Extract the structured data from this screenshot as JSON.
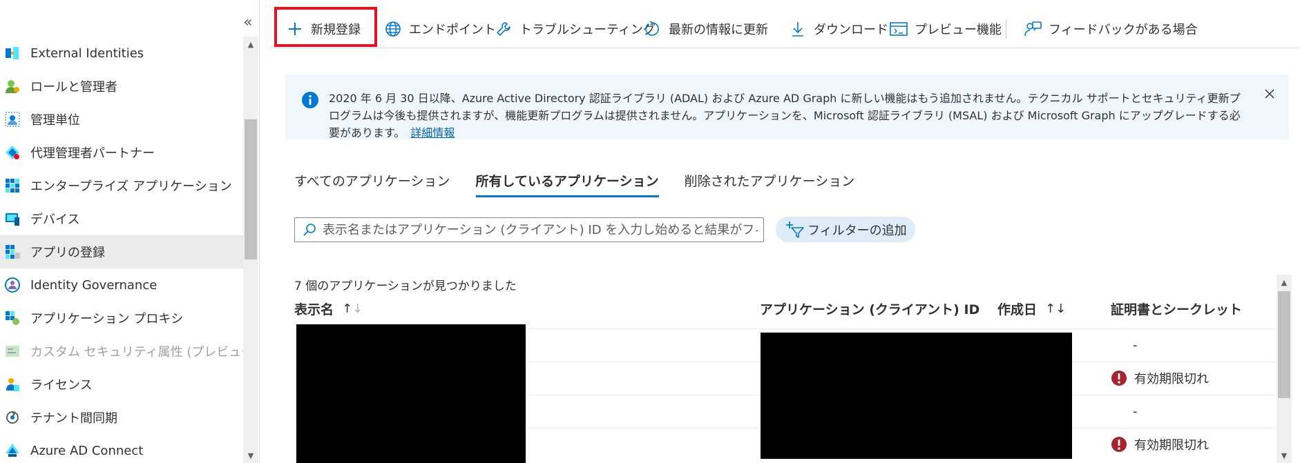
{
  "sidebar": {
    "collapse_glyph": "«",
    "items": [
      {
        "label": "External Identities",
        "icon": "external-identities-icon"
      },
      {
        "label": "ロールと管理者",
        "icon": "roles-admins-icon"
      },
      {
        "label": "管理単位",
        "icon": "admin-units-icon"
      },
      {
        "label": "代理管理者パートナー",
        "icon": "delegated-admin-partners-icon"
      },
      {
        "label": "エンタープライズ アプリケーション",
        "icon": "enterprise-apps-icon"
      },
      {
        "label": "デバイス",
        "icon": "devices-icon"
      },
      {
        "label": "アプリの登録",
        "icon": "app-registrations-icon",
        "selected": true
      },
      {
        "label": "Identity Governance",
        "icon": "identity-governance-icon"
      },
      {
        "label": "アプリケーション プロキシ",
        "icon": "app-proxy-icon"
      },
      {
        "label": "カスタム セキュリティ属性 (プレビュー)",
        "icon": "custom-security-attributes-icon",
        "disabled": true
      },
      {
        "label": "ライセンス",
        "icon": "licenses-icon"
      },
      {
        "label": "テナント間同期",
        "icon": "cross-tenant-sync-icon"
      },
      {
        "label": "Azure AD Connect",
        "icon": "azure-ad-connect-icon"
      }
    ]
  },
  "toolbar": {
    "new_registration": "新規登録",
    "endpoints": "エンドポイント",
    "troubleshooting": "トラブルシューティング",
    "refresh": "最新の情報に更新",
    "download": "ダウンロード",
    "preview_features": "プレビュー機能",
    "feedback": "フィードバックがある場合"
  },
  "banner": {
    "text": "2020 年 6 月 30 日以降、Azure Active Directory 認証ライブラリ (ADAL) および Azure AD Graph に新しい機能はもう追加されません。テクニカル サポートとセキュリティ更新プログラムは今後も提供されますが、機能更新プログラムは提供されません。アプリケーションを、Microsoft 認証ライブラリ (MSAL) および Microsoft Graph にアップグレードする必要があります。",
    "link": "詳細情報"
  },
  "tabs": [
    {
      "label": "すべてのアプリケーション",
      "active": false
    },
    {
      "label": "所有しているアプリケーション",
      "active": true
    },
    {
      "label": "削除されたアプリケーション",
      "active": false
    }
  ],
  "search": {
    "placeholder": "表示名またはアプリケーション (クライアント) ID を入力し始めると結果がフィル..."
  },
  "filter": {
    "label": "フィルターの追加"
  },
  "results": {
    "count_text": "7 個のアプリケーションが見つかりました"
  },
  "table": {
    "columns": {
      "display_name": "表示名",
      "app_id": "アプリケーション (クライアント) ID",
      "created": "作成日",
      "certs": "証明書とシークレット"
    },
    "sort_glyph_up": "↑",
    "sort_glyph_down": "↓",
    "rows": [
      {
        "certs": "-",
        "status": "none"
      },
      {
        "certs": "有効期限切れ",
        "status": "error"
      },
      {
        "certs": "-",
        "status": "none"
      },
      {
        "certs": "有効期限切れ",
        "status": "error"
      }
    ]
  },
  "colors": {
    "accent": "#0078d4",
    "highlight_box": "#e81123",
    "banner_bg": "#eff6fc",
    "error": "#a4262c",
    "link": "#0062ad"
  }
}
